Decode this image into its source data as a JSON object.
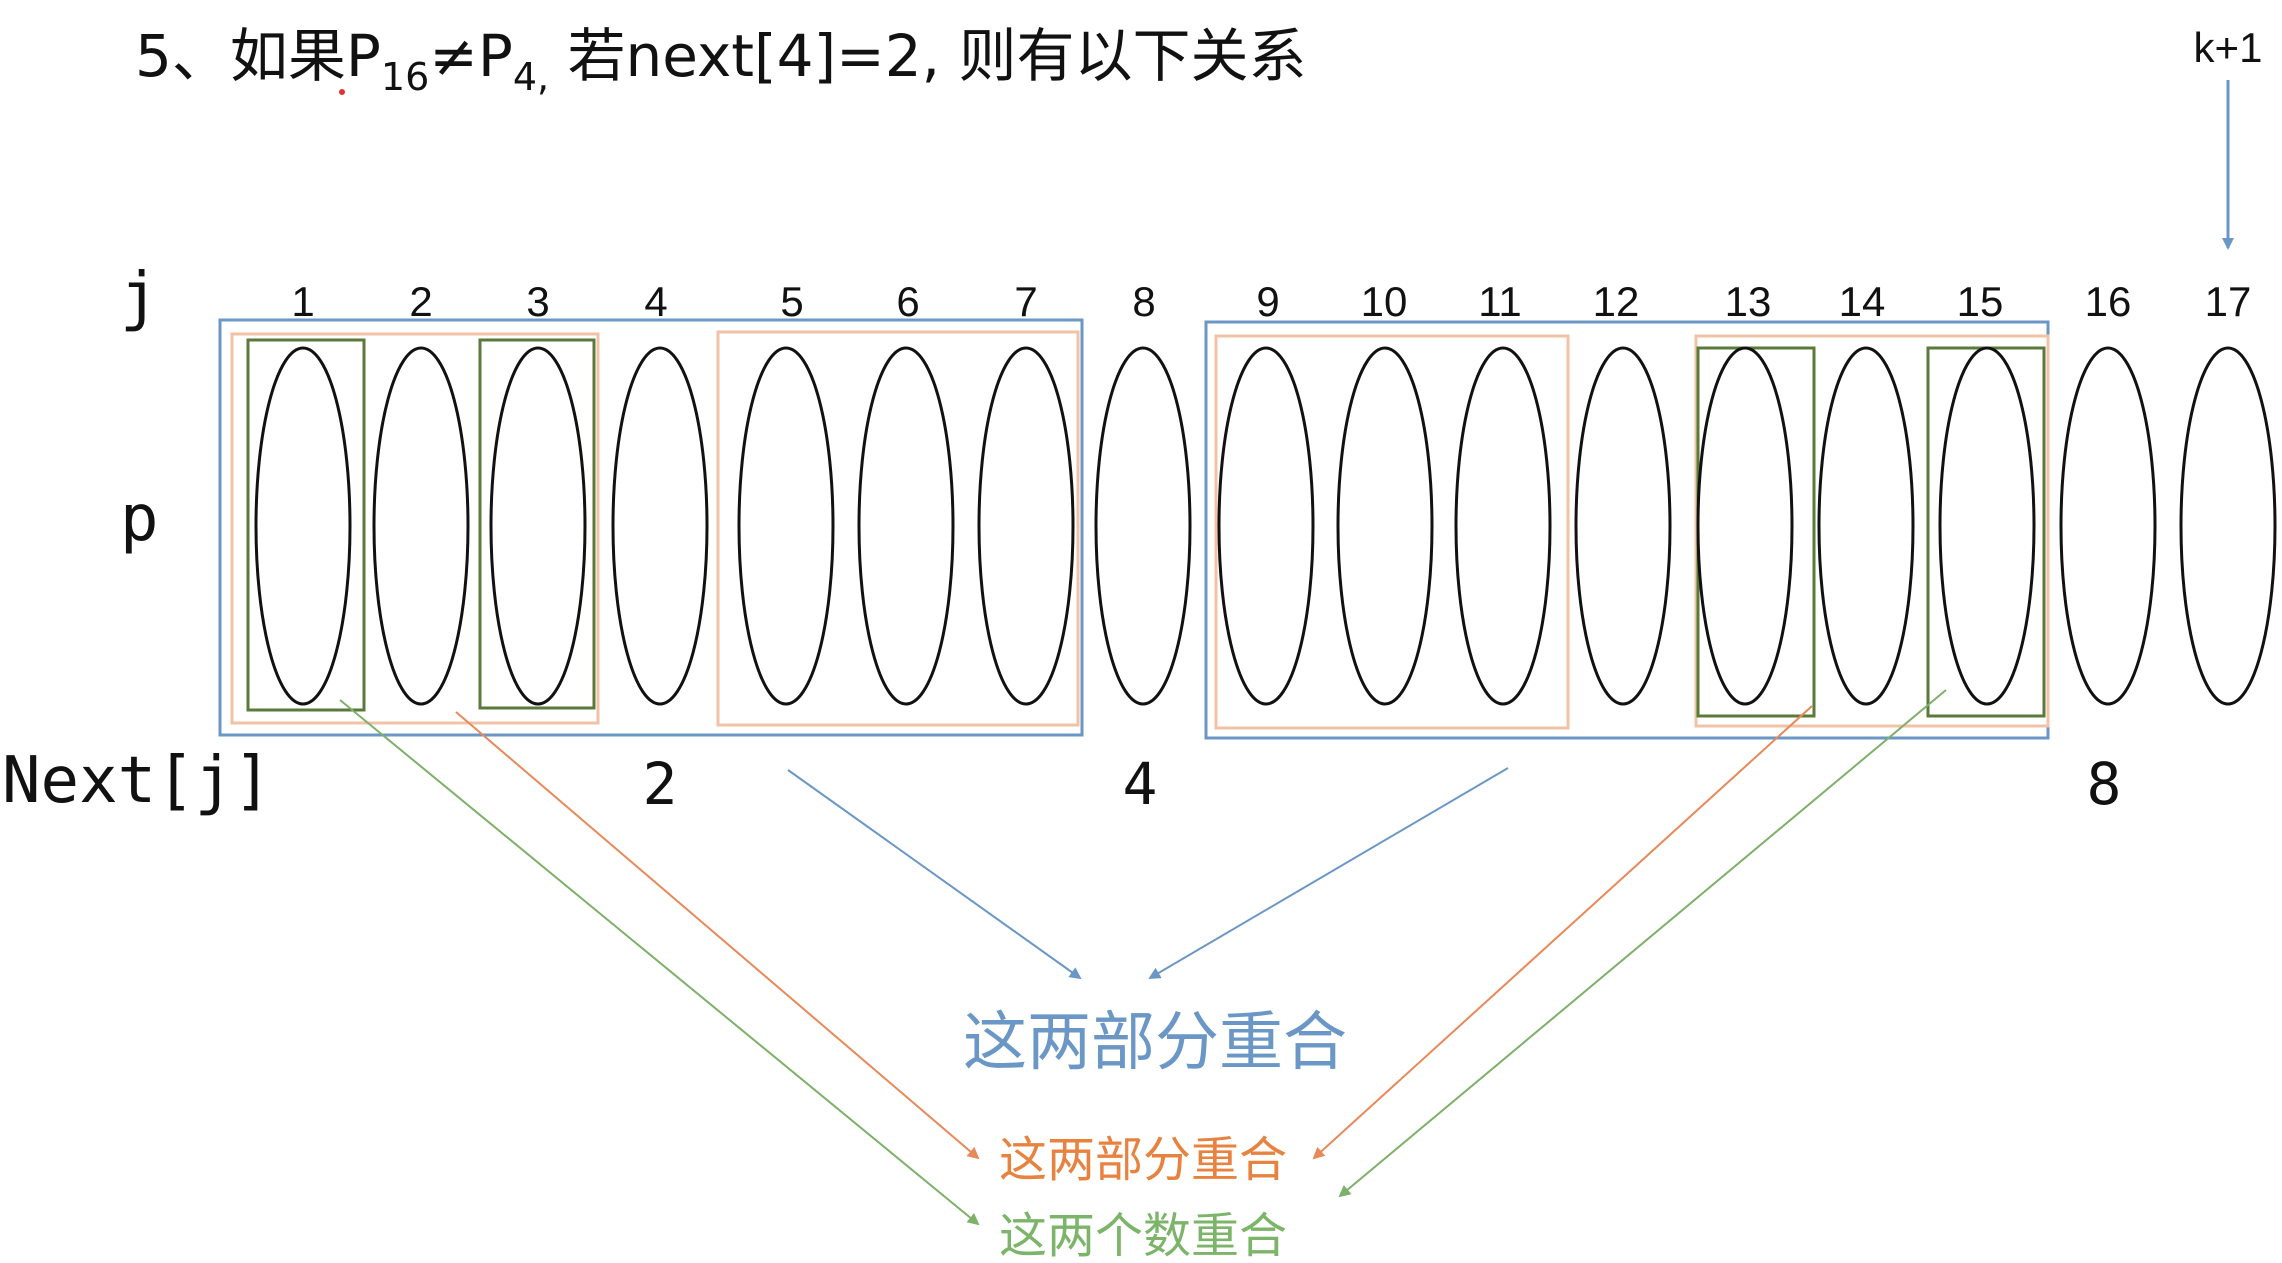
{
  "title": {
    "prefix": "5、如果P",
    "sub16": "16",
    "neq": "≠P",
    "sub4": "4,",
    "suffix": " 若next[4]=2, 则有以下关系"
  },
  "pointer_label": "k+1",
  "row_labels": {
    "j": "j",
    "p": "p",
    "next": "Next[j]"
  },
  "indices": [
    "1",
    "2",
    "3",
    "4",
    "5",
    "6",
    "7",
    "8",
    "9",
    "10",
    "11",
    "12",
    "13",
    "14",
    "15",
    "16",
    "17"
  ],
  "next_values": [
    {
      "label": "2",
      "after_index": "4"
    },
    {
      "label": "4",
      "after_index": "8"
    },
    {
      "label": "8",
      "after_index": "16"
    }
  ],
  "notes": {
    "blue": "这两部分重合",
    "orange": "这两部分重合",
    "green": "这两个数重合"
  },
  "colors": {
    "blue": "#6b97c6",
    "orange": "#f0c3a6",
    "orange_arrow": "#e8895a",
    "green": "#5a7a3a",
    "green_arrow": "#7fb06a",
    "note_blue": "#6b97c6",
    "note_orange": "#e8823f",
    "note_green": "#7cb56a"
  }
}
